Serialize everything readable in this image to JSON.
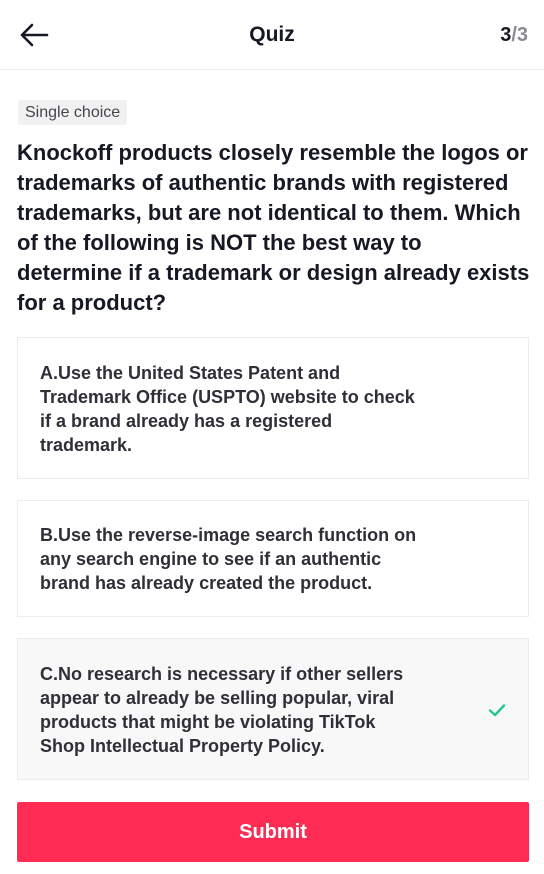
{
  "header": {
    "title": "Quiz",
    "progress_current": "3",
    "progress_separator": "/",
    "progress_total": "3",
    "back_icon": "arrow-left-icon"
  },
  "question": {
    "type_label": "Single choice",
    "text": "Knockoff products closely resemble the logos or trademarks of authentic brands with registered trademarks, but are not identical to them. Which of the following is NOT the best way to determine if a trademark or design already exists for a product?"
  },
  "options": [
    {
      "label": "A.Use the United States Patent and Trademark Office (USPTO) website to check if a brand already has a registered trademark.",
      "selected": false
    },
    {
      "label": "B.Use the reverse-image search function on any search engine to see if an authentic brand has already created the product.",
      "selected": false
    },
    {
      "label": "C.No research is necessary if other sellers appear to already be selling popular, viral products that might be violating TikTok Shop Intellectual Property Policy.",
      "selected": true
    }
  ],
  "submit_label": "Submit",
  "colors": {
    "accent": "#fe2c55",
    "check": "#25c490",
    "text_primary": "#161823",
    "text_muted": "#8a8b91"
  }
}
